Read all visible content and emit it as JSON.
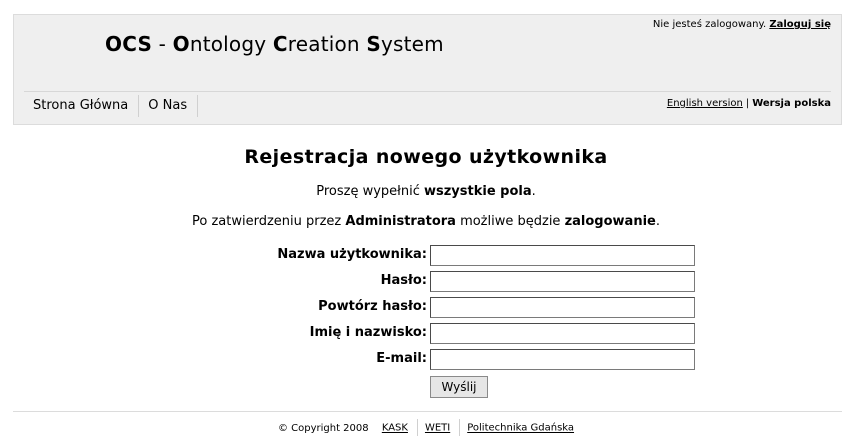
{
  "header": {
    "title_parts": [
      {
        "text": "OCS",
        "bold": true
      },
      {
        "text": " - ",
        "bold": false
      },
      {
        "text": "O",
        "bold": true
      },
      {
        "text": "ntology ",
        "bold": false
      },
      {
        "text": "C",
        "bold": true
      },
      {
        "text": "reation ",
        "bold": false
      },
      {
        "text": "S",
        "bold": true
      },
      {
        "text": "ystem",
        "bold": false
      }
    ],
    "login_status": "Nie jesteś zalogowany.",
    "login_link": "Zaloguj się"
  },
  "nav": {
    "items": [
      "Strona Główna",
      "O Nas"
    ]
  },
  "language": {
    "english": "English version",
    "separator": "|",
    "polish": "Wersja polska"
  },
  "main": {
    "heading": "Rejestracja nowego użytkownika",
    "intro1_a": "Proszę wypełnić ",
    "intro1_b": "wszystkie pola",
    "intro1_c": ".",
    "intro2_a": "Po zatwierdzeniu przez ",
    "intro2_b": "Administratora",
    "intro2_c": " możliwe będzie ",
    "intro2_d": "zalogowanie",
    "intro2_e": "."
  },
  "form": {
    "fields": [
      {
        "label": "Nazwa użytkownika:",
        "value": ""
      },
      {
        "label": "Hasło:",
        "value": ""
      },
      {
        "label": "Powtórz hasło:",
        "value": ""
      },
      {
        "label": "Imię i nazwisko:",
        "value": ""
      },
      {
        "label": "E-mail:",
        "value": ""
      }
    ],
    "submit_label": "Wyślij"
  },
  "footer": {
    "copyright": "© Copyright 2008",
    "links": [
      "KASK",
      "WETI",
      "Politechnika Gdańska"
    ]
  }
}
